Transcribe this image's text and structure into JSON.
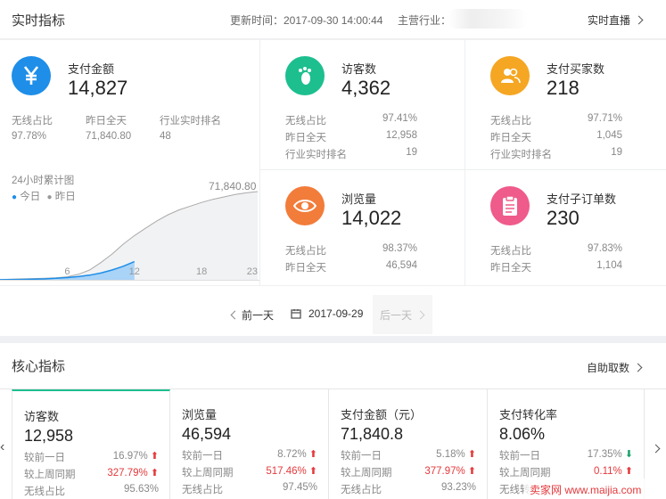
{
  "header": {
    "title": "实时指标",
    "update_time": "更新时间：2017-09-30 14:00:44",
    "industry_label": "主营行业：",
    "live_label": "实时直播"
  },
  "pay_amount": {
    "name": "支付金额",
    "value": "14,827",
    "icon": "yuan-icon",
    "color": "#1e8ee8",
    "stats": [
      {
        "label": "无线占比",
        "value": "97.78%"
      },
      {
        "label": "昨日全天",
        "value": "71,840.80"
      },
      {
        "label": "行业实时排名",
        "value": "48"
      }
    ]
  },
  "chart_title": "24小时累计图",
  "legend": {
    "today": "今日",
    "yesterday": "昨日"
  },
  "chart_data": {
    "type": "area",
    "x": [
      0,
      1,
      2,
      3,
      4,
      5,
      6,
      7,
      8,
      9,
      10,
      11,
      12,
      13,
      14,
      15,
      16,
      17,
      18,
      19,
      20,
      21,
      22,
      23
    ],
    "series": [
      {
        "name": "今日",
        "values": [
          100,
          200,
          300,
          500,
          700,
          1200,
          1800,
          2600,
          3800,
          5500,
          8000,
          11000,
          14827
        ]
      },
      {
        "name": "昨日",
        "values": [
          200,
          500,
          800,
          1000,
          1200,
          1600,
          2500,
          4500,
          8000,
          14000,
          21000,
          29000,
          36000,
          42000,
          48000,
          53000,
          57000,
          60000,
          63000,
          65500,
          67500,
          69500,
          70800,
          71840.8
        ]
      }
    ],
    "xticks": [
      "6",
      "12",
      "18",
      "23"
    ],
    "annotation": "71,840.80"
  },
  "visitors": {
    "name": "访客数",
    "value": "4,362",
    "icon": "footprint-icon",
    "color": "#1dbf8f",
    "stats": [
      {
        "label": "无线占比",
        "value": "97.41%"
      },
      {
        "label": "昨日全天",
        "value": "12,958"
      },
      {
        "label": "行业实时排名",
        "value": "19"
      }
    ]
  },
  "buyers": {
    "name": "支付买家数",
    "value": "218",
    "icon": "users-icon",
    "color": "#f5a623",
    "stats": [
      {
        "label": "无线占比",
        "value": "97.71%"
      },
      {
        "label": "昨日全天",
        "value": "1,045"
      },
      {
        "label": "行业实时排名",
        "value": "19"
      }
    ]
  },
  "pageviews": {
    "name": "浏览量",
    "value": "14,022",
    "icon": "eye-icon",
    "color": "#f27c3a",
    "stats": [
      {
        "label": "无线占比",
        "value": "98.37%"
      },
      {
        "label": "昨日全天",
        "value": "46,594"
      }
    ]
  },
  "suborders": {
    "name": "支付子订单数",
    "value": "230",
    "icon": "clipboard-icon",
    "color": "#ef5b8a",
    "stats": [
      {
        "label": "无线占比",
        "value": "97.83%"
      },
      {
        "label": "昨日全天",
        "value": "1,104"
      }
    ]
  },
  "date_nav": {
    "prev": "前一天",
    "date": "2017-09-29",
    "next": "后一天"
  },
  "core": {
    "title": "核心指标",
    "action": "自助取数",
    "cards": [
      {
        "name": "访客数",
        "value": "12,958",
        "rows": [
          {
            "label": "较前一日",
            "value": "16.97%",
            "dir": "up"
          },
          {
            "label": "较上周同期",
            "value": "327.79%",
            "dir": "up"
          },
          {
            "label": "无线占比",
            "value": "95.63%",
            "dir": ""
          }
        ]
      },
      {
        "name": "浏览量",
        "value": "46,594",
        "rows": [
          {
            "label": "较前一日",
            "value": "8.72%",
            "dir": "up"
          },
          {
            "label": "较上周同期",
            "value": "517.46%",
            "dir": "up"
          },
          {
            "label": "无线占比",
            "value": "97.45%",
            "dir": ""
          }
        ]
      },
      {
        "name": "支付金额（元）",
        "value": "71,840.8",
        "rows": [
          {
            "label": "较前一日",
            "value": "5.18%",
            "dir": "up"
          },
          {
            "label": "较上周同期",
            "value": "377.97%",
            "dir": "up"
          },
          {
            "label": "无线占比",
            "value": "93.23%",
            "dir": ""
          }
        ]
      },
      {
        "name": "支付转化率",
        "value": "8.06%",
        "rows": [
          {
            "label": "较前一日",
            "value": "17.35%",
            "dir": "down"
          },
          {
            "label": "较上周同期",
            "value": "0.11%",
            "dir": "up"
          },
          {
            "label": "无线转",
            "value": "",
            "dir": ""
          }
        ]
      }
    ]
  },
  "watermark": "卖家网 www.maijia.com"
}
